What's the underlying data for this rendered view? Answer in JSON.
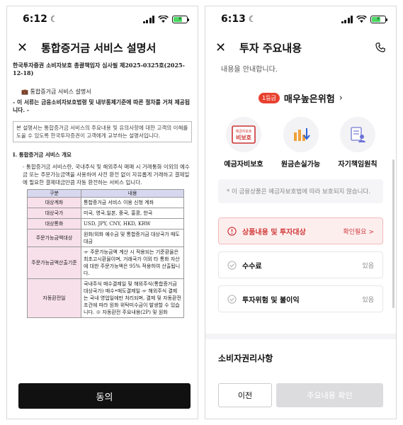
{
  "left": {
    "status_time": "6:12",
    "title": "통합증거금 서비스 설명서",
    "doc_line": "한국투자증권 소비자보호 총괄책임자 심사필 제2025-0325호(2025-12-18)",
    "subtitle": "통합증거금 서비스 설명서",
    "warning": "- 이 서류는 금융소비자보호법령 및 내부통제기준에 따른 절차를 거쳐 제공됩니다. -",
    "intro_box": "본 설명서는 통합증거금 서비스의 주요내용 및 유의사항에 대한 고객의 이해를 도울 수 있도록 한국투자증권이 고객에게 교부하는 설명서입니다.",
    "section": "I. 통합증거금 서비스 개요",
    "paragraph": "- 통합증거금 서비스란, 국내주식 및 해외주식 매매 시 거래통화 이외의 예수금 또는 주문가능금액을 사용하여 사전 환전 없이 자유롭게 거래하고 결제일에 필요한 결제대금만큼 자동 환전하는 서비스 입니다.",
    "table": {
      "headers": [
        "구분",
        "내용"
      ],
      "rows": [
        [
          "대상계좌",
          "통합증거금 서비스 이용 신청 계좌"
        ],
        [
          "대상국가",
          "미국, 영국,일본, 중국, 홍콩, 한국"
        ],
        [
          "대상통화",
          "USD, JPY, CNY, HKD, KRW"
        ],
        [
          "주문가능금액대상",
          "원화/외화 예수금 및 통합증거금 대상국가 매도대금"
        ],
        [
          "주문가능금액산출기준",
          "☞ 주문가능금액 계산 시 적용되는 기준환율은 최초고시환율이며, 거래국가 이외 타 통화 자산에 대한 주문가능액은 95% 적용하여 산출됩니다."
        ],
        [
          "자동환전일",
          "국내주식 매수결제일 및 해외주식(통합증거금 대상국가) 매수•매도결제일 ☞ 해외주식 결제는 국내 영업일에만 처리되며, 결제 및 자동환전 조건에 따라 원화 위탁미수금이 발생할 수 있습니다. ※ 자동환전 주요내용(2P) 및 원화"
        ]
      ]
    },
    "agree_label": "동의"
  },
  "right": {
    "status_time": "6:13",
    "title": "투자 주요내용",
    "cut_text": "내용을 안내합니다.",
    "risk_badge": "1등급",
    "risk_text": "매우높은위험",
    "icon_items": [
      {
        "label": "예금자비보호",
        "icon": "no-deposit-protection-icon",
        "stamp": "예금자보호 비보호"
      },
      {
        "label": "원금손실가능",
        "icon": "principal-loss-icon"
      },
      {
        "label": "자기책임원칙",
        "icon": "self-responsibility-icon"
      }
    ],
    "note": "* 이 금융상품은 예금자보호법에 따라 보호되지 않습니다.",
    "cards": [
      {
        "title": "상품내용 및 투자대상",
        "status": "확인필요 >"
      },
      {
        "title": "수수료",
        "status": "있음"
      },
      {
        "title": "투자위험 및 불이익",
        "status": "있음"
      }
    ],
    "consumer_rights": "소비자권리사항",
    "prev_label": "이전",
    "confirm_label": "주요내용 확인"
  },
  "colors": {
    "risk_red": "#e8412f",
    "alert_bg": "#fdeeee",
    "table_header": "#d7d7ef",
    "table_label": "#f8e0ea"
  }
}
